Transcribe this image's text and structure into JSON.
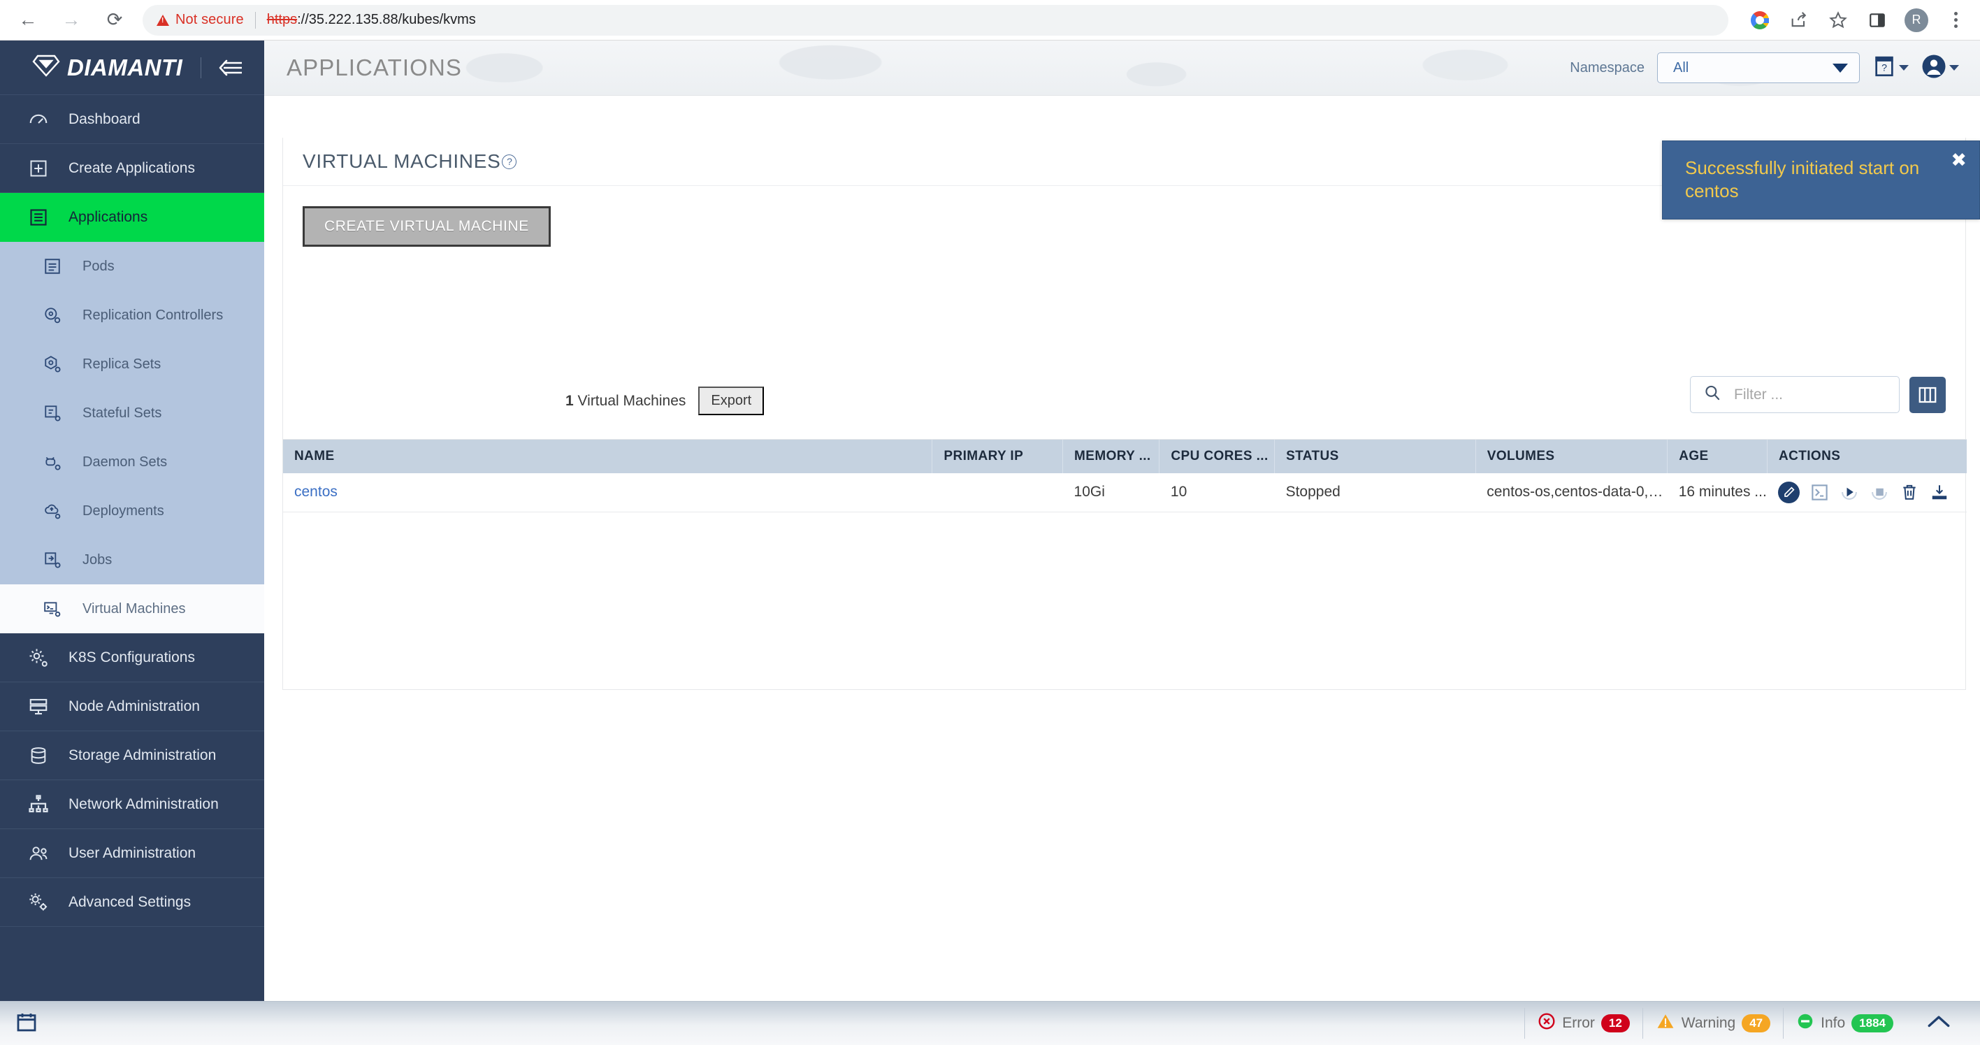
{
  "browser": {
    "back_icon": "back-arrow-icon",
    "forward_icon": "forward-arrow-icon",
    "reload_icon": "reload-icon",
    "security_label": "Not secure",
    "url_scheme": "https",
    "url_rest": "://35.222.135.88/kubes/kvms",
    "toolbar_icons": [
      "google-icon",
      "share-icon",
      "bookmark-star-icon",
      "side-panel-icon"
    ],
    "profile_initial": "R",
    "menu_icon": "kebab-menu-icon"
  },
  "sidebar": {
    "brand": "DIAMANTI",
    "collapse_icon": "collapse-sidebar-icon",
    "items": [
      {
        "label": "Dashboard",
        "icon": "gauge-icon"
      },
      {
        "label": "Create Applications",
        "icon": "plus-square-icon"
      },
      {
        "label": "Applications",
        "icon": "list-square-icon",
        "active": true
      }
    ],
    "subitems": [
      {
        "label": "Pods",
        "icon": "pods-icon"
      },
      {
        "label": "Replication Controllers",
        "icon": "replication-controllers-icon"
      },
      {
        "label": "Replica Sets",
        "icon": "replica-sets-icon"
      },
      {
        "label": "Stateful Sets",
        "icon": "stateful-sets-icon"
      },
      {
        "label": "Daemon Sets",
        "icon": "daemon-sets-icon"
      },
      {
        "label": "Deployments",
        "icon": "deployments-icon"
      },
      {
        "label": "Jobs",
        "icon": "jobs-icon"
      },
      {
        "label": "Virtual Machines",
        "icon": "virtual-machines-icon",
        "active": true
      }
    ],
    "lower_items": [
      {
        "label": "K8S Configurations",
        "icon": "gear-icon"
      },
      {
        "label": "Node Administration",
        "icon": "server-icon"
      },
      {
        "label": "Storage Administration",
        "icon": "database-icon"
      },
      {
        "label": "Network Administration",
        "icon": "network-icon"
      },
      {
        "label": "User Administration",
        "icon": "users-icon"
      },
      {
        "label": "Advanced Settings",
        "icon": "gears-icon"
      }
    ]
  },
  "header": {
    "title": "APPLICATIONS",
    "namespace_label": "Namespace",
    "namespace_value": "All",
    "help_icon": "help-book-icon",
    "user_icon": "user-avatar-icon"
  },
  "toast": {
    "message": "Successfully initiated start on centos",
    "close_icon": "close-icon",
    "bg_color": "#3d6394",
    "text_color": "#f2c94c"
  },
  "card": {
    "title": "VIRTUAL MACHINES",
    "help_icon": "help-circle-icon",
    "create_button": "CREATE VIRTUAL MACHINE",
    "count_text": "1 Virtual Machines",
    "count_number": "1",
    "count_suffix": " Virtual Machines",
    "export_button": "Export",
    "filter_placeholder": "Filter ...",
    "filter_value": "",
    "search_icon": "search-icon",
    "columns_icon": "columns-toggle-icon"
  },
  "table": {
    "columns": [
      "NAME",
      "PRIMARY IP",
      "MEMORY ...",
      "CPU CORES ...",
      "STATUS",
      "VOLUMES",
      "AGE",
      "ACTIONS"
    ],
    "rows": [
      {
        "name": "centos",
        "primary_ip": "",
        "memory": "10Gi",
        "cpu_cores": "10",
        "status": "Stopped",
        "volumes": "centos-os,centos-data-0,c...",
        "age": "16 minutes ...",
        "actions": [
          "edit-icon",
          "console-icon",
          "start-icon",
          "stop-icon",
          "delete-icon",
          "download-icon"
        ]
      }
    ]
  },
  "statusbar": {
    "calendar_icon": "calendar-events-icon",
    "items": [
      {
        "label": "Error",
        "count": "12",
        "kind": "err",
        "icon": "error-icon"
      },
      {
        "label": "Warning",
        "count": "47",
        "kind": "warn",
        "icon": "warning-icon"
      },
      {
        "label": "Info",
        "count": "1884",
        "kind": "info",
        "icon": "info-icon"
      }
    ],
    "expand_icon": "chevron-up-icon"
  },
  "colors": {
    "sidebar_bg": "#2e3f5c",
    "active_green": "#00d84a",
    "subnav_bg": "#b3c5de",
    "toast_bg": "#3d6394",
    "link_blue": "#3b6fc4",
    "table_header_bg": "#c5d2e0"
  }
}
